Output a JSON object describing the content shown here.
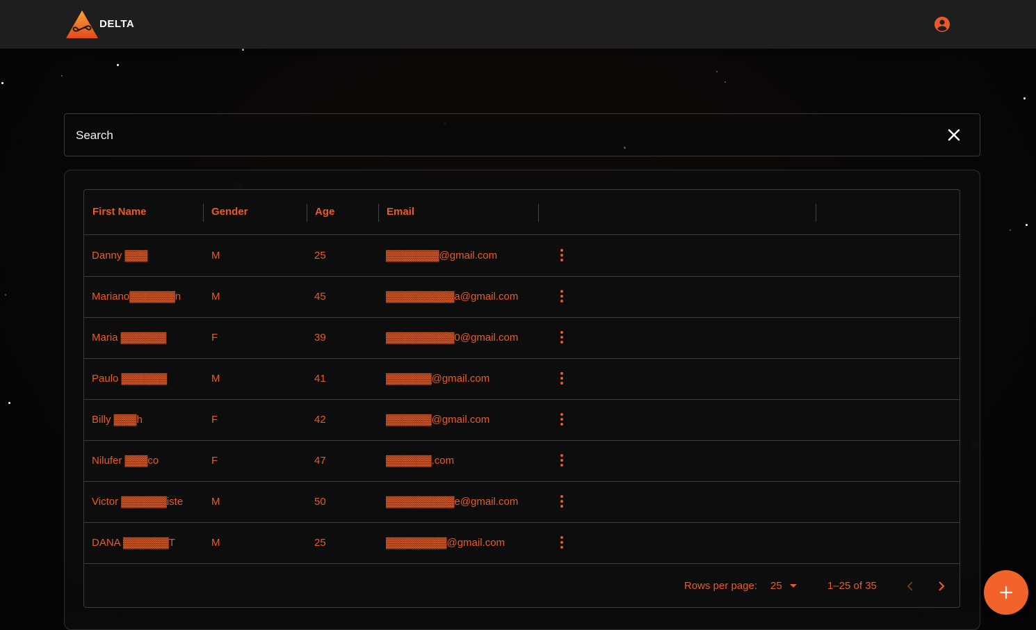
{
  "header": {
    "brand": "DELTA",
    "logo_icon": "delta-triangle-infinity-icon",
    "account_icon": "account-circle-icon"
  },
  "search": {
    "placeholder": "Search",
    "clear_icon": "close-icon"
  },
  "table": {
    "columns": [
      "First Name",
      "Gender",
      "Age",
      "Email"
    ],
    "rows": [
      {
        "first_name": "Danny ▓▓▓",
        "gender": "M",
        "age": "25",
        "email": "▓▓▓▓▓▓▓@gmail.com"
      },
      {
        "first_name": "Mariano▓▓▓▓▓▓n",
        "gender": "M",
        "age": "45",
        "email": "▓▓▓▓▓▓▓▓▓a@gmail.com"
      },
      {
        "first_name": "Maria ▓▓▓▓▓▓",
        "gender": "F",
        "age": "39",
        "email": "▓▓▓▓▓▓▓▓▓0@gmail.com"
      },
      {
        "first_name": "Paulo ▓▓▓▓▓▓",
        "gender": "M",
        "age": "41",
        "email": "▓▓▓▓▓▓@gmail.com"
      },
      {
        "first_name": "Billy ▓▓▓h",
        "gender": "F",
        "age": "42",
        "email": "▓▓▓▓▓▓@gmail.com"
      },
      {
        "first_name": "Nilufer ▓▓▓co",
        "gender": "F",
        "age": "47",
        "email": "▓▓▓▓▓▓.com"
      },
      {
        "first_name": "Victor ▓▓▓▓▓▓iste",
        "gender": "M",
        "age": "50",
        "email": "▓▓▓▓▓▓▓▓▓e@gmail.com"
      },
      {
        "first_name": "DANA ▓▓▓▓▓▓T",
        "gender": "M",
        "age": "25",
        "email": "▓▓▓▓▓▓▓▓@gmail.com"
      }
    ],
    "row_menu_icon": "more-vert-icon"
  },
  "pagination": {
    "rows_per_page_label": "Rows per page:",
    "rows_per_page_value": "25",
    "range": "1–25 of 35",
    "prev_icon": "chevron-left-icon",
    "next_icon": "chevron-right-icon"
  },
  "fab": {
    "icon": "plus-icon"
  },
  "colors": {
    "accent": "#e85b28",
    "background": "#070606",
    "topbar": "#1e1e1e"
  }
}
